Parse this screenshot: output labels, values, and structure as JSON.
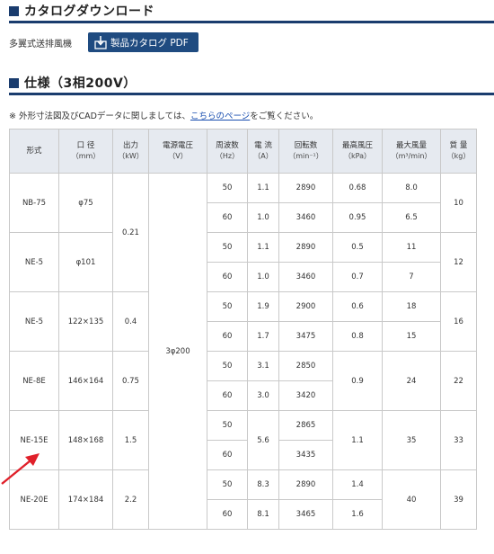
{
  "catalog": {
    "title": "カタログダウンロード",
    "model_label": "多翼式送排風機",
    "pdf_button_label": "製品カタログ PDF"
  },
  "spec": {
    "title": "仕様（3相200V）",
    "note_prefix": "※ 外形寸法図及びCADデータに関しましては、",
    "note_link": "こちらのページ",
    "note_suffix": "をご覧ください。",
    "headers": [
      {
        "label": "形式",
        "unit": ""
      },
      {
        "label": "口 径",
        "unit": "（mm）"
      },
      {
        "label": "出力",
        "unit": "（kW）"
      },
      {
        "label": "電源電圧",
        "unit": "（V）"
      },
      {
        "label": "周波数",
        "unit": "（Hz）"
      },
      {
        "label": "電 流",
        "unit": "（A）"
      },
      {
        "label": "回転数",
        "unit": "（min⁻¹）"
      },
      {
        "label": "最高風圧",
        "unit": "（kPa）"
      },
      {
        "label": "最大風量",
        "unit": "（m³/min）"
      },
      {
        "label": "質 量",
        "unit": "（kg）"
      }
    ],
    "voltage": "3φ200",
    "models": [
      {
        "name": "NB-75",
        "diameter": "φ75",
        "weight": "10"
      },
      {
        "name": "NE-5",
        "diameter": "φ101",
        "weight": "12"
      },
      {
        "name": "NE-5",
        "diameter": "122×135",
        "weight": "16"
      },
      {
        "name": "NE-8E",
        "diameter": "146×164",
        "weight": "22"
      },
      {
        "name": "NE-15E",
        "diameter": "148×168",
        "weight": "33"
      },
      {
        "name": "NE-20E",
        "diameter": "174×184",
        "weight": "39"
      }
    ],
    "outputs": [
      "0.21",
      "0.4",
      "0.75",
      "1.5",
      "2.2"
    ],
    "rows": [
      {
        "hz": "50",
        "current": "1.1",
        "rpm": "2890",
        "pressure": "0.68",
        "flow": "8.0"
      },
      {
        "hz": "60",
        "current": "1.0",
        "rpm": "3460",
        "pressure": "0.95",
        "flow": "6.5"
      },
      {
        "hz": "50",
        "current": "1.1",
        "rpm": "2890",
        "pressure": "0.5",
        "flow": "11"
      },
      {
        "hz": "60",
        "current": "1.0",
        "rpm": "3460",
        "pressure": "0.7",
        "flow": "7"
      },
      {
        "hz": "50",
        "current": "1.9",
        "rpm": "2900",
        "pressure": "0.6",
        "flow": "18"
      },
      {
        "hz": "60",
        "current": "1.7",
        "rpm": "3475",
        "pressure": "0.8",
        "flow": "15"
      },
      {
        "hz": "50",
        "current": "3.1",
        "rpm": "2850",
        "pressure": "0.9",
        "flow": "24"
      },
      {
        "hz": "60",
        "current": "3.0",
        "rpm": "3420"
      },
      {
        "hz": "50",
        "current": "5.6",
        "rpm": "2865",
        "pressure": "1.1",
        "flow": "35"
      },
      {
        "hz": "60",
        "rpm": "3435"
      },
      {
        "hz": "50",
        "current": "8.3",
        "rpm": "2890",
        "pressure": "1.4",
        "flow": "40"
      },
      {
        "hz": "60",
        "current": "8.1",
        "rpm": "3465",
        "pressure": "1.6"
      }
    ]
  },
  "colors": {
    "accent": "#1a3c6e",
    "button": "#1f4b80",
    "header_bg": "#e6eaf0",
    "arrow": "#e0202a",
    "link": "#1a4fb0"
  }
}
